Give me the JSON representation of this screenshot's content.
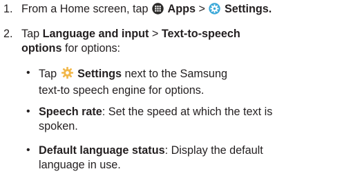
{
  "steps": [
    {
      "number": "1.",
      "pre": "From a Home screen, tap ",
      "apps_label": "Apps",
      "sep": " > ",
      "settings_label": "Settings."
    },
    {
      "number": "2.",
      "pre": "Tap ",
      "lang_label": "Language and input",
      "sep": " > ",
      "tts_label_1": "Text-to-speech",
      "tts_label_2": "options",
      "post": " for options:"
    }
  ],
  "bullets": [
    {
      "pre": "Tap ",
      "bold": "Settings",
      "line1_rest": " next to the Samsung",
      "line2": "text-to speech engine for options."
    },
    {
      "bold": "Speech rate",
      "line1_rest": ": Set the speed at which the text is",
      "line2": "spoken."
    },
    {
      "bold": "Default language status",
      "line1_rest": ": Display the default",
      "line2": "language in use."
    }
  ],
  "icons": {
    "apps": "apps-grid-icon",
    "settings": "settings-gear-icon",
    "tts_settings": "gear-icon"
  },
  "colors": {
    "text": "#231f20",
    "apps_icon_bg": "#2b2a29",
    "settings_icon_blue": "#3aa8d8",
    "gear_icon": "#f2b84b"
  }
}
